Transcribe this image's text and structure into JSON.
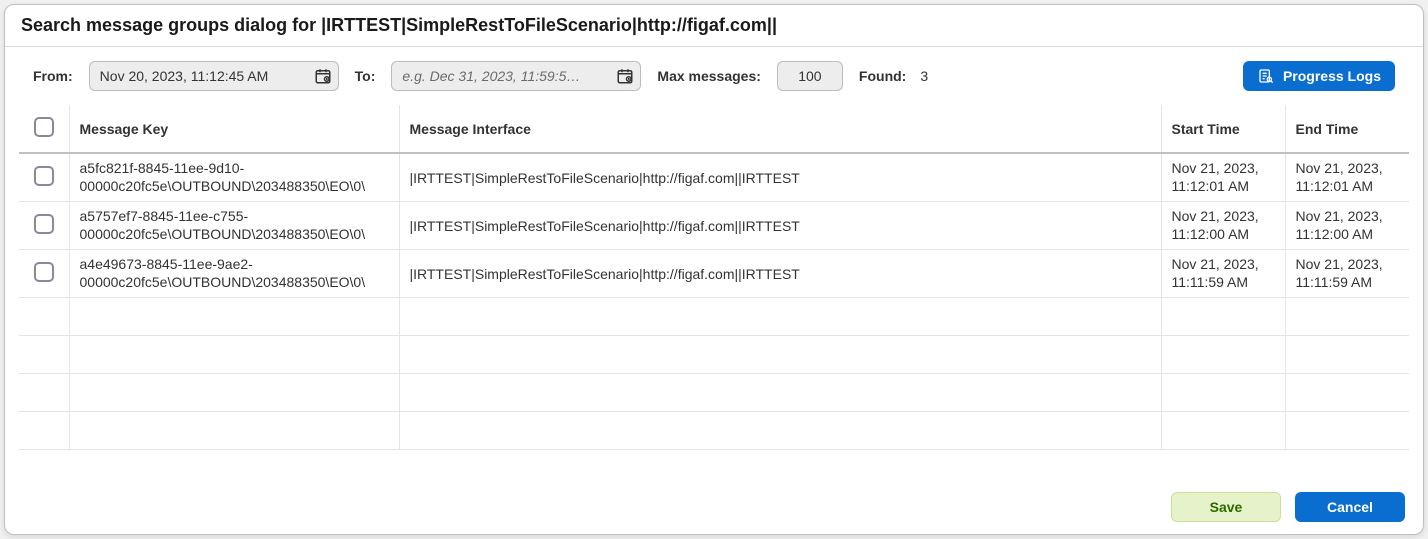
{
  "header": {
    "title": "Search message groups dialog for |IRTTEST|SimpleRestToFileScenario|http://figaf.com||"
  },
  "filters": {
    "from_label": "From:",
    "from_value": "Nov 20, 2023, 11:12:45 AM",
    "to_label": "To:",
    "to_placeholder": "e.g. Dec 31, 2023, 11:59:5…",
    "max_label": "Max messages:",
    "max_value": "100",
    "found_label": "Found:",
    "found_value": "3",
    "progress_logs_label": "Progress Logs"
  },
  "table": {
    "columns": {
      "message_key": "Message Key",
      "message_interface": "Message Interface",
      "start_time": "Start Time",
      "end_time": "End Time"
    },
    "rows": [
      {
        "key": "a5fc821f-8845-11ee-9d10-00000c20fc5e\\OUTBOUND\\203488350\\EO\\0\\",
        "iface": "|IRTTEST|SimpleRestToFileScenario|http://figaf.com||IRTTEST",
        "start": "Nov 21, 2023, 11:12:01 AM",
        "end": "Nov 21, 2023, 11:12:01 AM"
      },
      {
        "key": "a5757ef7-8845-11ee-c755-00000c20fc5e\\OUTBOUND\\203488350\\EO\\0\\",
        "iface": "|IRTTEST|SimpleRestToFileScenario|http://figaf.com||IRTTEST",
        "start": "Nov 21, 2023, 11:12:00 AM",
        "end": "Nov 21, 2023, 11:12:00 AM"
      },
      {
        "key": "a4e49673-8845-11ee-9ae2-00000c20fc5e\\OUTBOUND\\203488350\\EO\\0\\",
        "iface": "|IRTTEST|SimpleRestToFileScenario|http://figaf.com||IRTTEST",
        "start": "Nov 21, 2023, 11:11:59 AM",
        "end": "Nov 21, 2023, 11:11:59 AM"
      }
    ]
  },
  "footer": {
    "save": "Save",
    "cancel": "Cancel"
  }
}
